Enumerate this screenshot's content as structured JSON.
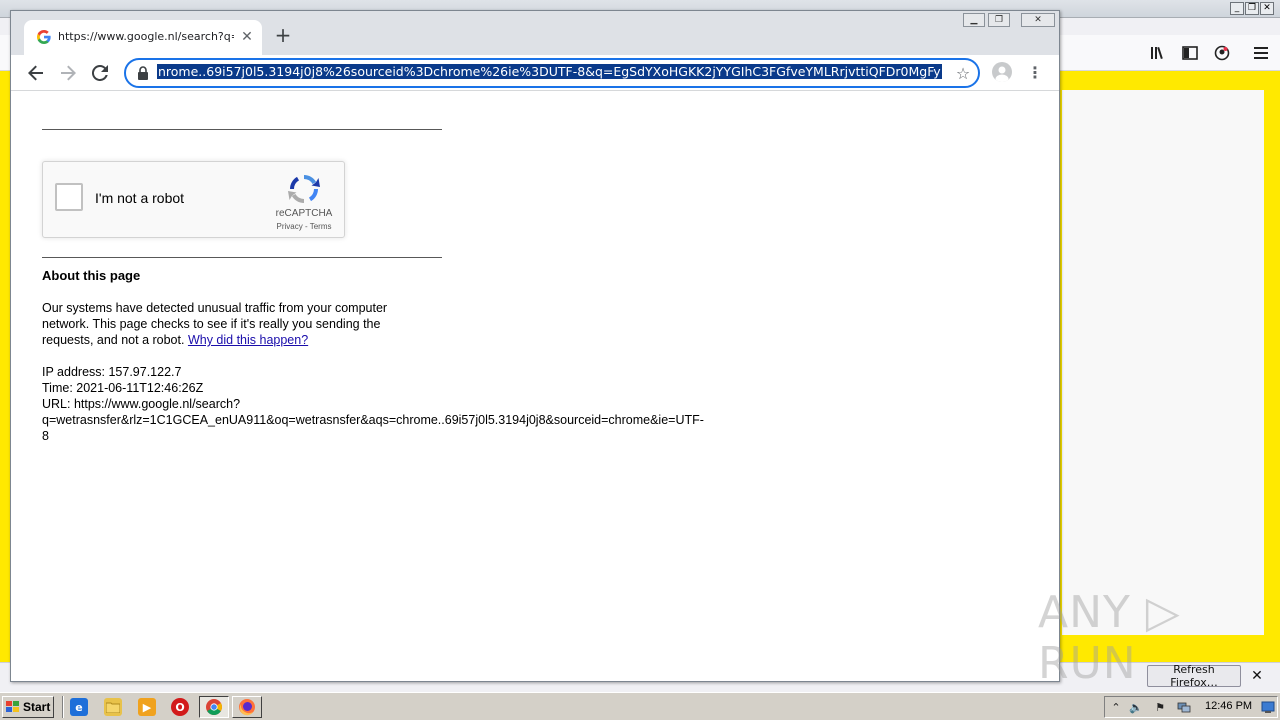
{
  "chrome": {
    "tab_title": "https://www.google.nl/search?q=w",
    "url_selected": "nrome..69i57j0l5.3194j0j8%26sourceid%3Dchrome%26ie%3DUTF-8&q=EgSdYXoHGKK2jYYGIhC3FGfveYMLRrjvttiQFDr0MgFy"
  },
  "page": {
    "recaptcha_label": "I'm not a robot",
    "recaptcha_brand": "reCAPTCHA",
    "recaptcha_privacy": "Privacy",
    "recaptcha_sep": " - ",
    "recaptcha_terms": "Terms",
    "about_title": "About this page",
    "about_text": "Our systems have detected unusual traffic from your computer network. This page checks to see if it's really you sending the requests, and not a robot. ",
    "why_link": "Why did this happen?",
    "ip_line": "IP address: 157.97.122.7",
    "time_line": "Time: 2021-06-11T12:46:26Z",
    "url_line_1": "URL: https://www.google.nl/search?",
    "url_line_2": "q=wetrasnsfer&rlz=1C1GCEA_enUA911&oq=wetrasnsfer&aqs=chrome..69i57j0l5.3194j0j8&sourceid=chrome&ie=UTF-",
    "url_line_3": "8"
  },
  "firefox": {
    "refresh_button": "Refresh Firefox…"
  },
  "watermark": "ANY ▷ RUN",
  "taskbar": {
    "start_label": "Start",
    "clock": "12:46 PM"
  },
  "colors": {
    "firefox_content": "#ffe900",
    "omnibox_focus": "#1a73e8",
    "selection": "#0a3a8a",
    "link": "#1a0dab"
  }
}
